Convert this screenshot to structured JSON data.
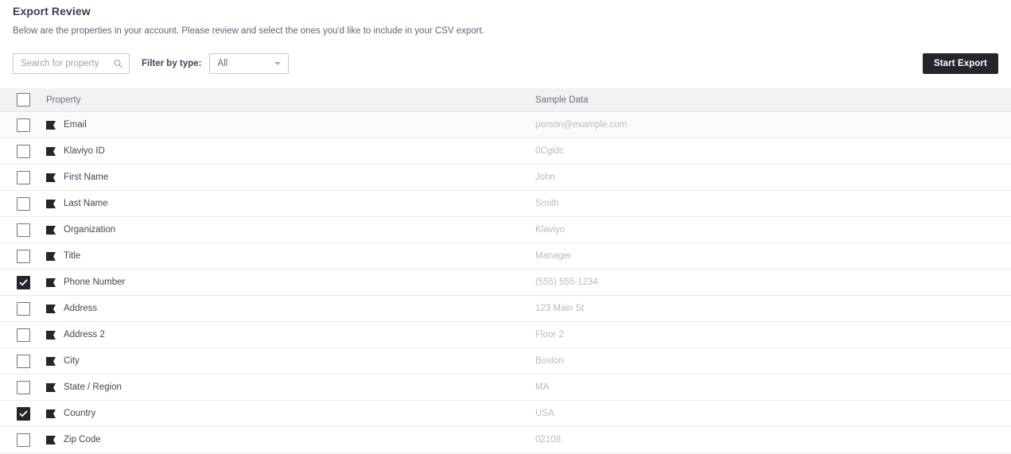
{
  "page": {
    "title": "Export Review",
    "subtitle": "Below are the properties in your account. Please review and select the ones you'd like to include in your CSV export."
  },
  "toolbar": {
    "search_placeholder": "Search for property",
    "search_value": "",
    "search_icon": "search-icon",
    "filter_label": "Filter by type:",
    "filter_selected": "All",
    "filter_options": [
      "All"
    ],
    "export_label": "Start Export"
  },
  "table": {
    "columns": {
      "property": "Property",
      "sample": "Sample Data"
    },
    "select_all_checked": false,
    "row_icon": "tag-icon",
    "rows": [
      {
        "label": "Email",
        "sample": "person@example.com",
        "checked": false
      },
      {
        "label": "Klaviyo ID",
        "sample": "0Cgidc",
        "checked": false
      },
      {
        "label": "First Name",
        "sample": "John",
        "checked": false
      },
      {
        "label": "Last Name",
        "sample": "Smith",
        "checked": false
      },
      {
        "label": "Organization",
        "sample": "Klaviyo",
        "checked": false
      },
      {
        "label": "Title",
        "sample": "Manager",
        "checked": false
      },
      {
        "label": "Phone Number",
        "sample": "(555) 555-1234",
        "checked": true
      },
      {
        "label": "Address",
        "sample": "123 Main St",
        "checked": false
      },
      {
        "label": "Address 2",
        "sample": "Floor 2",
        "checked": false
      },
      {
        "label": "City",
        "sample": "Boston",
        "checked": false
      },
      {
        "label": "State / Region",
        "sample": "MA",
        "checked": false
      },
      {
        "label": "Country",
        "sample": "USA",
        "checked": true
      },
      {
        "label": "Zip Code",
        "sample": "02108",
        "checked": false
      }
    ]
  },
  "colors": {
    "accent_dark": "#24262b",
    "header_bg": "#f1f2f4",
    "row_shaded_bg": "#fafbfb",
    "border": "#e9ebee",
    "text_primary": "#3c4858",
    "text_muted": "#b6bbc3"
  }
}
